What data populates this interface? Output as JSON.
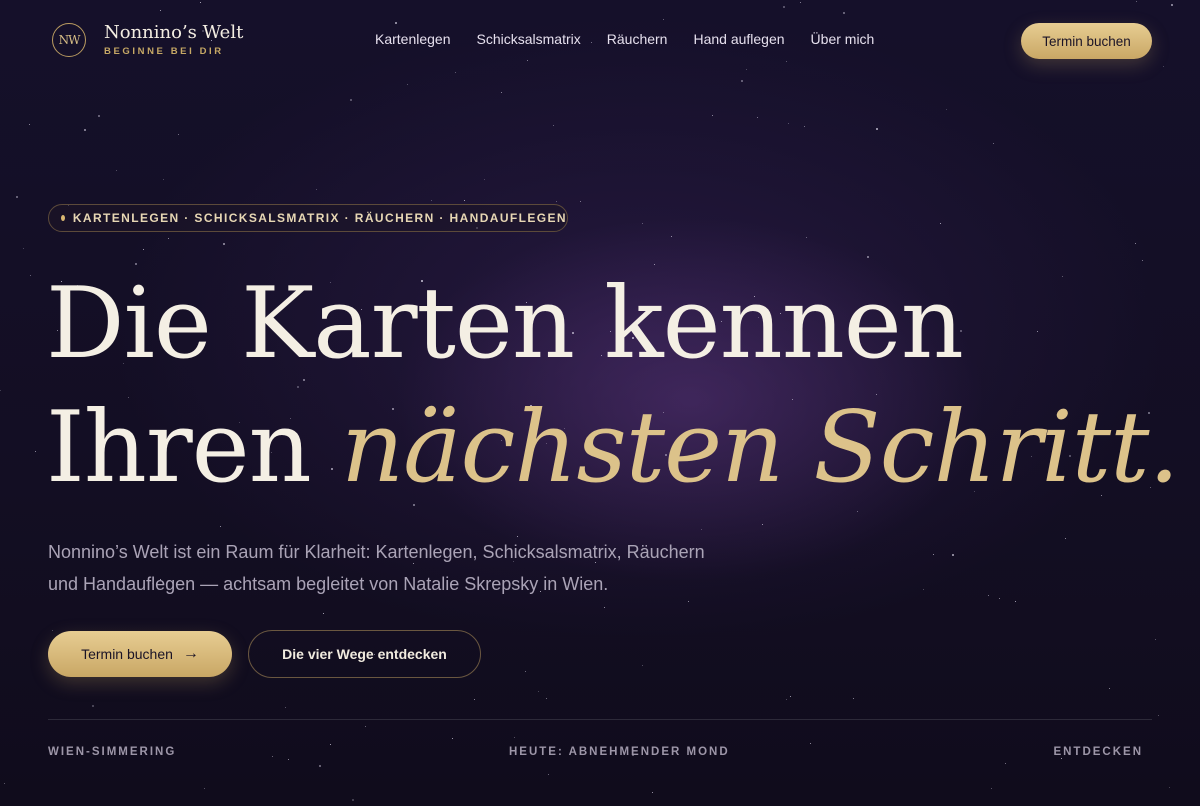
{
  "brand": {
    "monogram": "NW",
    "name": "Nonnino’s Welt",
    "tagline": "BEGINNE BEI DIR"
  },
  "nav": {
    "items": [
      "Kartenlegen",
      "Schicksalsmatrix",
      "Räuchern",
      "Hand auflegen",
      "Über mich"
    ]
  },
  "header": {
    "cta_label": "Termin buchen"
  },
  "hero": {
    "pill_text": "KARTENLEGEN · SCHICKSALSMATRIX · RÄUCHERN · HANDAUFLEGEN",
    "headline_line1": "Die Karten kennen",
    "headline_line2_plain": "Ihren",
    "headline_line2_accent": "nächsten Schritt.",
    "lead_line1": "Nonnino’s Welt ist ein Raum für Klarheit: Kartenlegen, Schicksalsmatrix, Räuchern",
    "lead_line2": "und Handauflegen — achtsam begleitet von Natalie Skrepsky in Wien.",
    "primary_cta": "Termin buchen",
    "primary_cta_arrow": "→",
    "secondary_cta": "Die vier Wege entdecken"
  },
  "footer_bar": {
    "location": "WIEN-SIMMERING",
    "moon": "HEUTE: ABNEHMENDER MOND",
    "explore": "ENTDECKEN"
  },
  "colors": {
    "background": "#120d1f",
    "gold": "#d9bd82",
    "text": "#f4efe4",
    "muted": "#aaa3b6"
  }
}
